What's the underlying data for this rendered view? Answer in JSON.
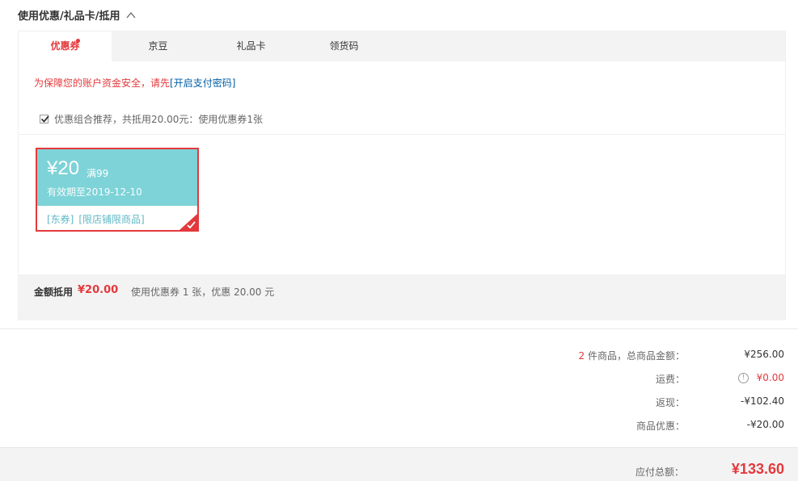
{
  "section": {
    "title": "使用优惠/礼品卡/抵用"
  },
  "tabs": [
    {
      "label": "优惠券",
      "active": true,
      "has_dot": true
    },
    {
      "label": "京豆",
      "active": false
    },
    {
      "label": "礼品卡",
      "active": false
    },
    {
      "label": "领货码",
      "active": false
    }
  ],
  "security": {
    "note": "为保障您的账户资金安全，请先",
    "link": "[开启支付密码]"
  },
  "combo": {
    "checked": true,
    "text": "优惠组合推荐，共抵用20.00元：使用优惠券1张"
  },
  "coupon": {
    "amount": "¥20",
    "condition": "满99",
    "valid": "有效期至2019-12-10",
    "tags": [
      "[东券]",
      "[限店铺限商品]"
    ],
    "selected": true,
    "colors": {
      "header": "#7dd3d7",
      "border": "#e4393c"
    }
  },
  "summary": {
    "label": "金额抵用",
    "amount": "¥20.00",
    "desc": "使用优惠券 1 张，优惠 20.00 元"
  },
  "totals": {
    "items_count": "2",
    "items_label": " 件商品，总商品金额：",
    "items_value": "¥256.00",
    "shipping_label": "运费：",
    "shipping_value": "¥0.00",
    "cashback_label": "返现：",
    "cashback_value": "-¥102.40",
    "discount_label": "商品优惠：",
    "discount_value": "-¥20.00"
  },
  "grand": {
    "label": "应付总额：",
    "value": "¥133.60"
  },
  "colors": {
    "accent": "#e4393c",
    "link": "#005ea7",
    "tab_bg": "#f3f3f3"
  }
}
